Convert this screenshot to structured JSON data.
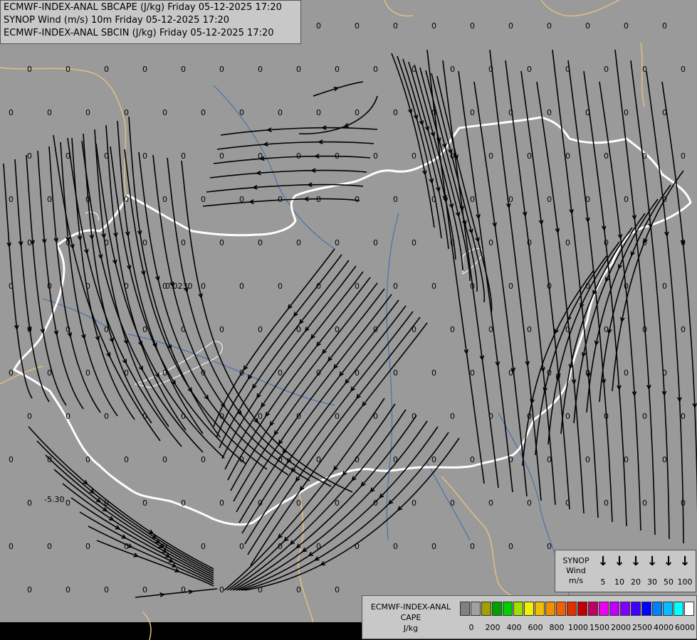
{
  "header": {
    "line1": "ECMWF-INDEX-ANAL SBCAPE (J/kg) Friday 05-12-2025 17:20",
    "line2": "SYNOP Wind (m/s) 10m Friday 05-12-2025 17:20",
    "line3": "ECMWF-INDEX-ANAL SBCIN (J/kg) Friday 05-12-2025 17:20"
  },
  "colors": {
    "background": "#9a9a9a",
    "streamline": "#000000",
    "border_white": "#ffffff",
    "border_tan": "#e0c080",
    "river": "#3a6bb0"
  },
  "map_labels": {
    "zero_label": "0",
    "cin_label_1": "0.0230",
    "cin_label_2": "-5.30"
  },
  "synop_legend": {
    "title_line1": "SYNOP",
    "title_line2": "Wind",
    "title_line3": "m/s",
    "arrow_icon": "arrow-down-icon",
    "values": [
      "5",
      "10",
      "20",
      "30",
      "50",
      "100"
    ]
  },
  "cape_legend": {
    "title_line1": "ECMWF-INDEX-ANAL",
    "title_line2": "CAPE",
    "title_line3": "J/kg",
    "swatch_colors": [
      "#808080",
      "#a0a0a0",
      "#a0a000",
      "#00a000",
      "#00d000",
      "#a0e000",
      "#f0f000",
      "#f0c000",
      "#f09000",
      "#f06000",
      "#e03000",
      "#c00000",
      "#c00060",
      "#f000f0",
      "#c000ff",
      "#8000ff",
      "#4000ff",
      "#0000ff",
      "#0080ff",
      "#00c0ff",
      "#00ffff",
      "#ffffff"
    ],
    "ticks": [
      "0",
      "200",
      "400",
      "600",
      "800",
      "1000",
      "1500",
      "2000",
      "2500",
      "4000",
      "6000"
    ]
  }
}
